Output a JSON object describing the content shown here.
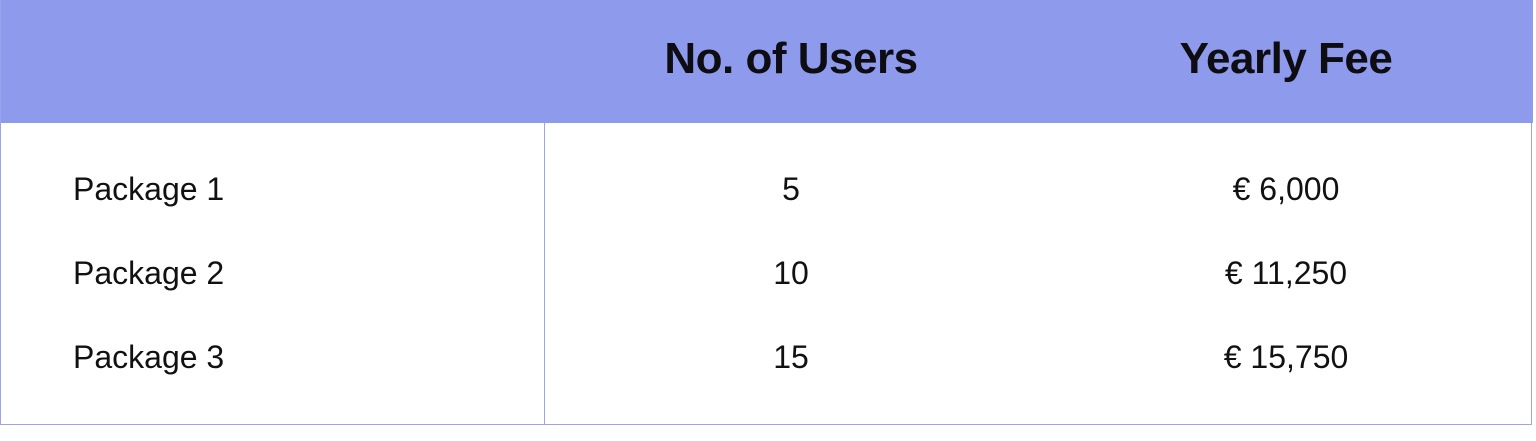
{
  "table": {
    "headers": {
      "package": "",
      "users": "No. of Users",
      "fee": "Yearly Fee"
    },
    "rows": [
      {
        "name": "Package 1",
        "users": "5",
        "fee": "€ 6,000"
      },
      {
        "name": "Package 2",
        "users": "10",
        "fee": "€ 11,250"
      },
      {
        "name": "Package 3",
        "users": "15",
        "fee": "€ 15,750"
      }
    ]
  },
  "colors": {
    "header_background": "#8e9bec",
    "border": "#9aa3ec",
    "text": "#111111"
  }
}
